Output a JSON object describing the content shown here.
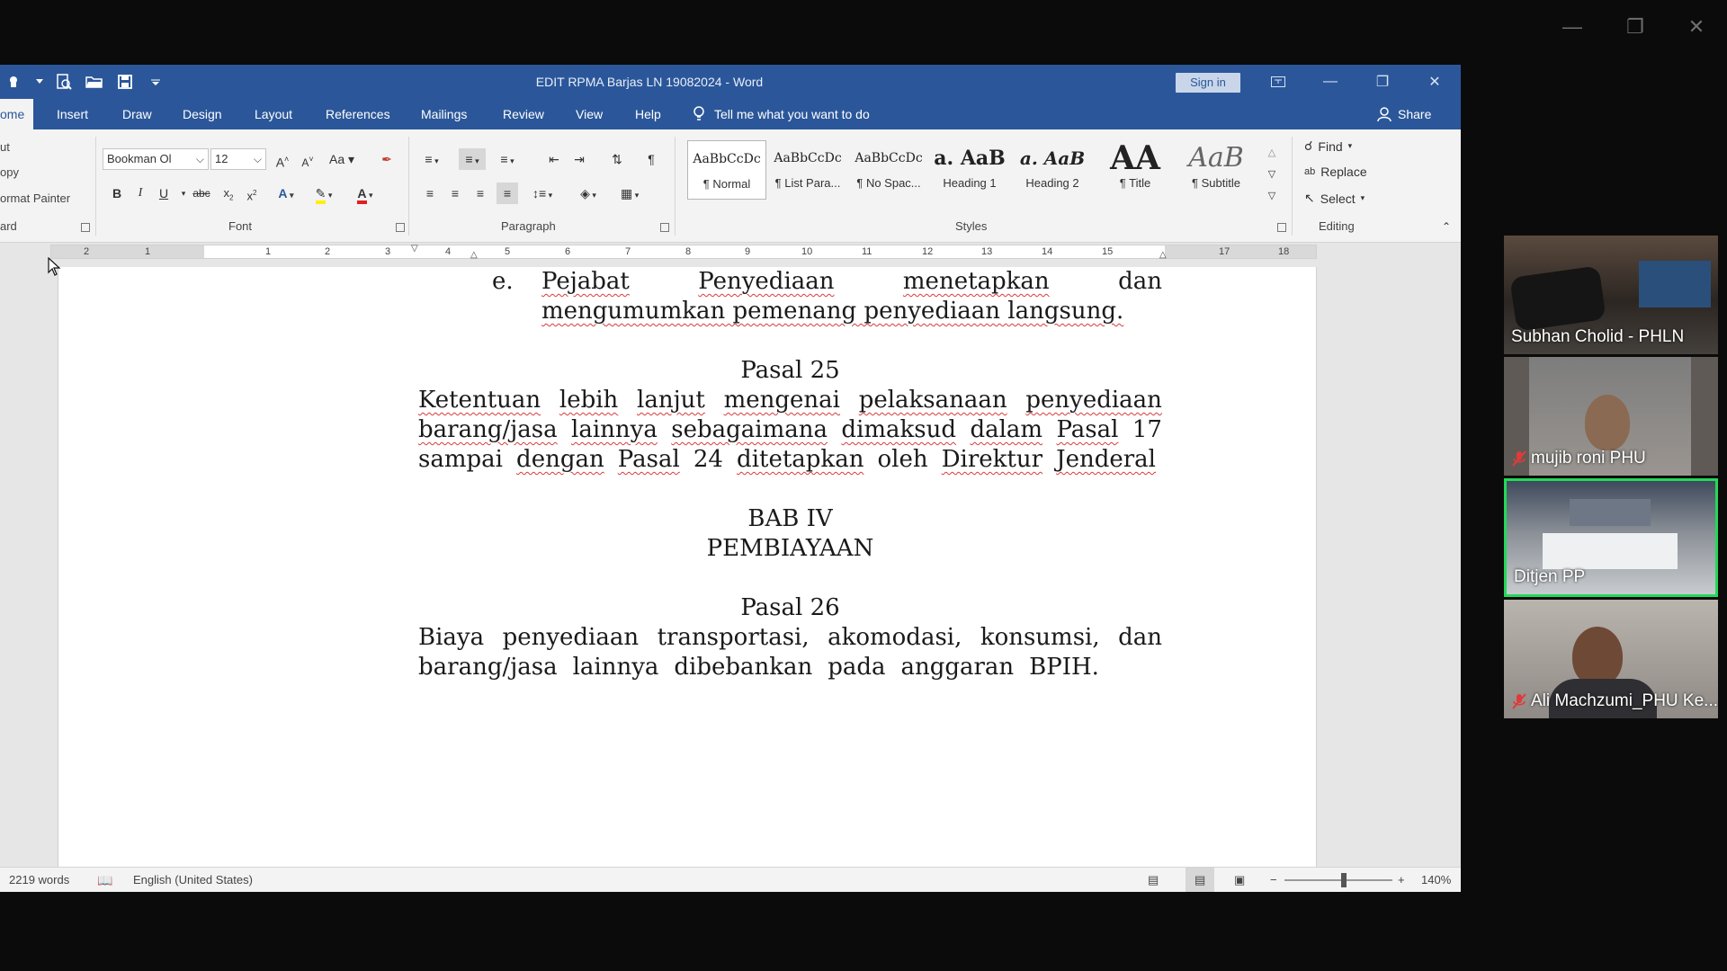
{
  "word": {
    "title": "EDIT RPMA Barjas LN 19082024  -  Word",
    "sign_in": "Sign in",
    "tabs": [
      "ome",
      "Insert",
      "Draw",
      "Design",
      "Layout",
      "References",
      "Mailings",
      "Review",
      "View",
      "Help"
    ],
    "tell_me": "Tell me what you want to do",
    "share": "Share",
    "clipboard": {
      "cut": "ut",
      "copy": "opy",
      "format_painter": "ormat Painter",
      "label": "ard"
    },
    "font": {
      "name": "Bookman Ol",
      "size": "12",
      "label": "Font",
      "case_btn": "Aa"
    },
    "paragraph": {
      "label": "Paragraph"
    },
    "styles": {
      "label": "Styles",
      "items": [
        {
          "sample": "AaBbCcDc",
          "name": "¶ Normal"
        },
        {
          "sample": "AaBbCcDc",
          "name": "¶ List Para..."
        },
        {
          "sample": "AaBbCcDc",
          "name": "¶ No Spac..."
        },
        {
          "sample": "a.  AaB",
          "name": "Heading 1"
        },
        {
          "sample": "a.  AaB",
          "name": "Heading 2"
        },
        {
          "sample": "AA",
          "name": "¶ Title"
        },
        {
          "sample": "AaB",
          "name": "¶ Subtitle"
        }
      ]
    },
    "editing": {
      "label": "Editing",
      "find": "Find",
      "replace": "Replace",
      "select": "Select"
    },
    "ruler_numbers": [
      "2",
      "1",
      "1",
      "2",
      "3",
      "4",
      "5",
      "6",
      "7",
      "8",
      "9",
      "10",
      "11",
      "12",
      "13",
      "14",
      "15",
      "17",
      "18"
    ],
    "status": {
      "words": "2219 words",
      "language": "English (United States)",
      "zoom": "140%"
    }
  },
  "document": {
    "item_e_marker": "e.",
    "item_e_line1": [
      "Pejabat",
      "Penyediaan",
      "menetapkan",
      "dan"
    ],
    "item_e_line2": "mengumumkan pemenang penyediaan langsung.",
    "pasal25_title": "Pasal 25",
    "pasal25_lines": [
      [
        "Ketentuan",
        "lebih",
        "lanjut",
        "mengenai",
        "pelaksanaan",
        "penyediaan"
      ],
      [
        "barang/jasa",
        "lainnya",
        "sebagaimana",
        "dimaksud",
        "dalam",
        "Pasal",
        "17"
      ],
      [
        "sampai",
        "dengan",
        "Pasal",
        "24",
        "ditetapkan",
        "oleh",
        "Direktur",
        "Jenderal"
      ]
    ],
    "bab_title": "BAB IV",
    "bab_subtitle": "PEMBIAYAAN",
    "pasal26_title": "Pasal 26",
    "pasal26_lines": [
      [
        "Biaya",
        "penyediaan",
        "transportasi,",
        "akomodasi,",
        "konsumsi,",
        "dan"
      ],
      [
        "barang/jasa",
        "lainnya",
        "dibebankan",
        "pada",
        "anggaran",
        "BPIH."
      ]
    ]
  },
  "participants": [
    {
      "name": "Subhan Cholid - PHLN",
      "muted": false,
      "active": false
    },
    {
      "name": "mujib roni PHU",
      "muted": true,
      "active": false
    },
    {
      "name": "Ditjen PP",
      "muted": false,
      "active": true
    },
    {
      "name": "Ali Machzumi_PHU Ke...",
      "muted": true,
      "active": false
    }
  ],
  "colors": {
    "word_blue": "#2b579a",
    "active_speaker": "#23d959",
    "spellcheck": "#d83b3b"
  }
}
